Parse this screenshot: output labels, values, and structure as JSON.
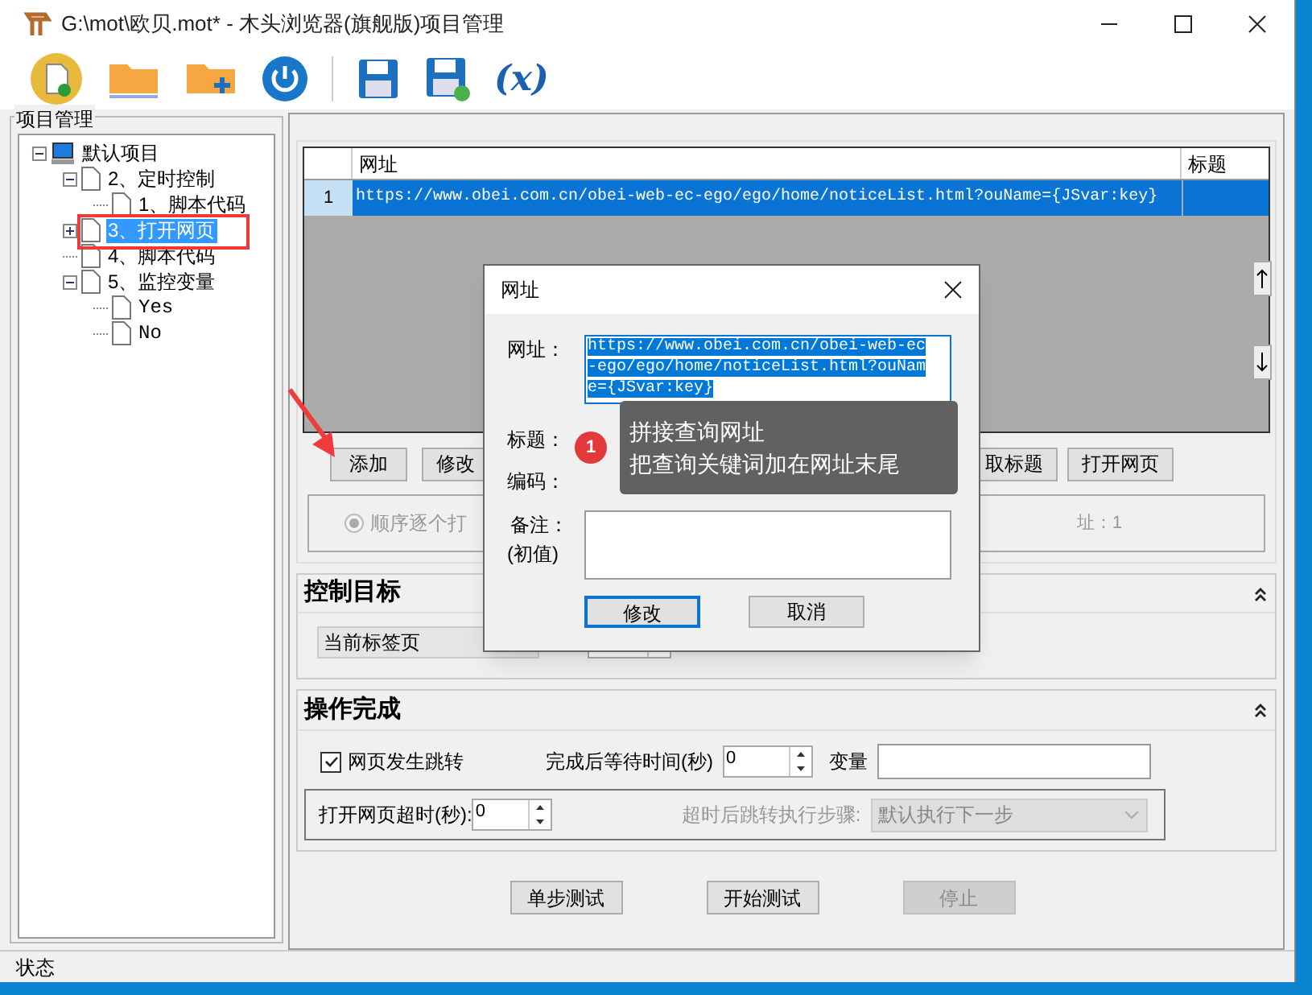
{
  "window": {
    "title": "G:\\mot\\欧贝.mot* - 木头浏览器(旗舰版)项目管理"
  },
  "toolbar": [
    {
      "kind": "new"
    },
    {
      "kind": "open"
    },
    {
      "kind": "add-folder"
    },
    {
      "kind": "power"
    },
    {
      "kind": "save"
    },
    {
      "kind": "save-as"
    },
    {
      "kind": "variable",
      "label": "(x)"
    }
  ],
  "project_panel": {
    "title": "项目管理",
    "tree": [
      {
        "label": "默认项目",
        "kind": "root",
        "expanded": true,
        "selected": false,
        "children": [
          {
            "label": "2、定时控制",
            "kind": "doc",
            "expanded": true,
            "selected": false,
            "children": [
              {
                "label": "1、脚本代码",
                "kind": "doc",
                "selected": false
              }
            ]
          },
          {
            "label": "3、打开网页",
            "kind": "doc",
            "expanded": false,
            "selected": true
          },
          {
            "label": "4、脚本代码",
            "kind": "doc",
            "selected": false
          },
          {
            "label": "5、监控变量",
            "kind": "doc",
            "expanded": true,
            "selected": false,
            "children": [
              {
                "label": "Yes",
                "kind": "value",
                "selected": false
              },
              {
                "label": "No",
                "kind": "value",
                "selected": false
              }
            ]
          }
        ]
      }
    ]
  },
  "url_table": {
    "columns": [
      "网址",
      "标题"
    ],
    "rows": [
      {
        "index": "1",
        "url": "https://www.obei.com.cn/obei-web-ec-ego/ego/home/noticeList.html?ouName={JSvar:key}",
        "selected": true
      }
    ]
  },
  "buttons": [
    "添加",
    "修改",
    "取标题",
    "打开网页"
  ],
  "open_mode": {
    "label": "顺序逐个打",
    "checked": true,
    "disabled": true,
    "url_count": "址：1"
  },
  "control_target": {
    "title": "控制目标",
    "expanded": true,
    "target": "当前标签页"
  },
  "completion": {
    "title": "操作完成",
    "expanded": true,
    "navigates": {
      "label": "网页发生跳转",
      "checked": true
    },
    "wait_label": "完成后等待时间(秒)",
    "wait_value": "0",
    "variable_label": "变量",
    "timeout_label": "打开网页超时(秒):",
    "timeout_value": "0",
    "timeout_step_label": "超时后跳转执行步骤:",
    "timeout_step_value": "默认执行下一步",
    "timeout_step_disabled": true
  },
  "actions": [
    {
      "label": "单步测试",
      "disabled": false
    },
    {
      "label": "开始测试",
      "disabled": false
    },
    {
      "label": "停止",
      "disabled": true
    }
  ],
  "status_bar": "状态",
  "dialog": {
    "title": "网址",
    "url_label": "网址：",
    "url_value": "https://www.obei.com.cn/obei-web-ec-ego/ego/home/noticeList.html?ouName={JSvar:key}",
    "title_label": "标题：",
    "encoding_label": "编码：",
    "note_label": "备注：",
    "note_sub": "(初值)",
    "buttons": [
      {
        "label": "修改",
        "focused": true
      },
      {
        "label": "取消",
        "focused": false
      }
    ]
  },
  "tooltip": {
    "badge": "1",
    "lines": [
      "拼接查询网址",
      "把查询关键词加在网址末尾"
    ]
  }
}
